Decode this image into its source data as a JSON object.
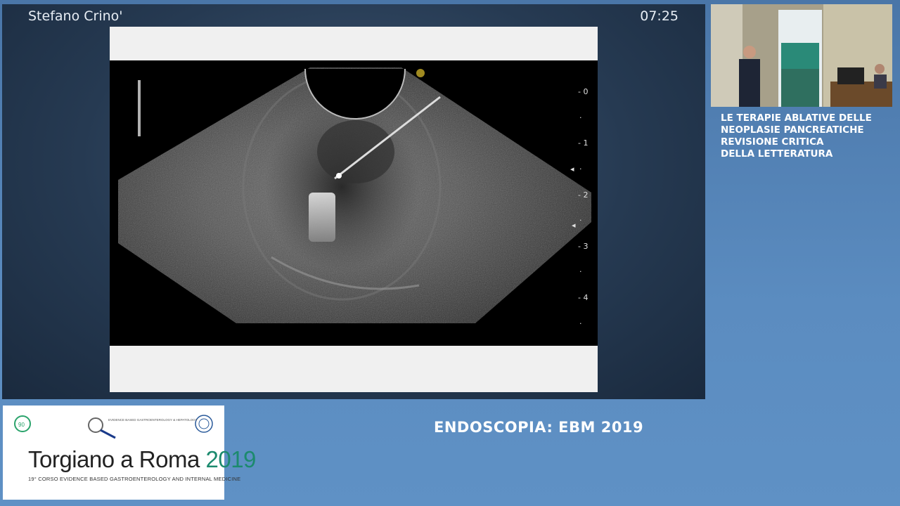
{
  "overlay": {
    "speaker": "Stefano Crino'",
    "time": "07:25"
  },
  "ultrasound": {
    "depth_labels": [
      "0",
      "1",
      "2",
      "3",
      "4"
    ]
  },
  "sidebar": {
    "title_lines": [
      "LE TERAPIE ABLATIVE DELLE",
      "NEOPLASIE PANCREATICHE",
      "REVISIONE CRITICA",
      "DELLA LETTERATURA"
    ]
  },
  "event": {
    "name": "ENDOSCOPIA: EBM 2019"
  },
  "logo": {
    "title_main": "Torgiano a Roma ",
    "title_year": "2019",
    "subtitle": "19° CORSO EVIDENCE BASED GASTROENTEROLOGY AND INTERNAL MEDICINE",
    "small_text": "EVIDENCE BASED GASTROENTEROLOGY & HEPATOLOGY"
  },
  "colors": {
    "background": "#5b8cc0",
    "panel": "#263a52",
    "logo_accent": "#1c8a6e"
  }
}
